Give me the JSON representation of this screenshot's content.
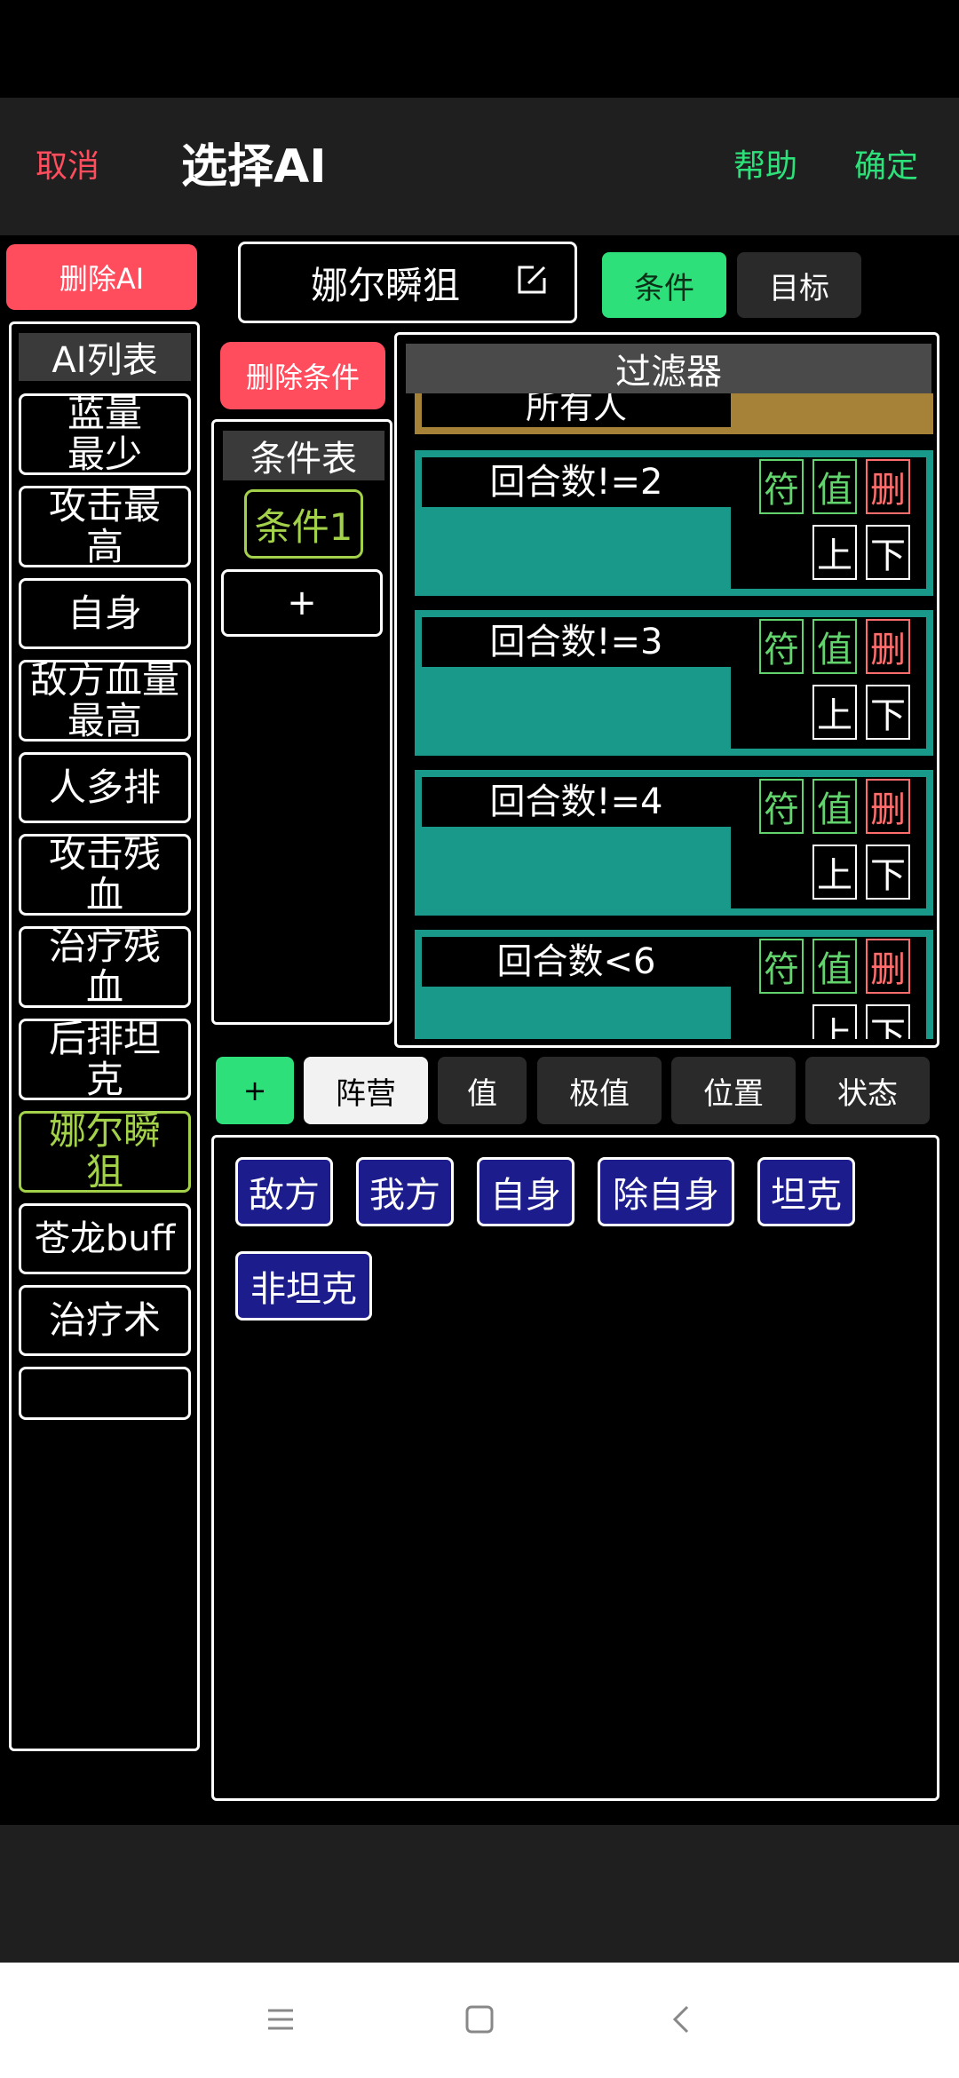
{
  "header": {
    "cancel": "取消",
    "title": "选择AI",
    "help": "帮助",
    "confirm": "确定"
  },
  "left_panel": {
    "delete_ai": "删除AI",
    "list_title": "AI列表",
    "items": [
      "蓝量最少",
      "攻击最高",
      "自身",
      "敌方血量最高",
      "人多排",
      "攻击残血",
      "治疗残血",
      "后排坦克",
      "娜尔瞬狙",
      "苍龙buff",
      "治疗术"
    ],
    "selected_index": 8
  },
  "editor": {
    "name": "娜尔瞬狙",
    "tabs": {
      "condition": "条件",
      "target": "目标"
    },
    "active_tab": "condition"
  },
  "condition_panel": {
    "delete_condition": "删除条件",
    "title": "条件表",
    "items": [
      "条件1"
    ],
    "add": "+"
  },
  "filter_panel": {
    "title": "过滤器",
    "partial_item": "所有人",
    "items": [
      "回合数!=2",
      "回合数!=3",
      "回合数!=4",
      "回合数<6"
    ],
    "actions": {
      "symbol": "符",
      "value": "值",
      "delete": "删",
      "up": "上",
      "down": "下"
    }
  },
  "category_tabs": {
    "add": "+",
    "items": [
      "阵营",
      "值",
      "极值",
      "位置",
      "状态"
    ],
    "active": "阵营"
  },
  "options": [
    "敌方",
    "我方",
    "自身",
    "除自身",
    "坦克",
    "非坦克"
  ],
  "colors": {
    "accent_green": "#2ee07a",
    "danger_red": "#ff4d5e",
    "selected_lime": "#a3d14a",
    "filter_teal": "#18998a",
    "filter_gold": "#a58238",
    "option_blue": "#1c1c8c"
  },
  "icons": {
    "edit": "edit-icon",
    "nav_menu": "menu-icon",
    "nav_home": "home-icon",
    "nav_back": "back-icon"
  }
}
